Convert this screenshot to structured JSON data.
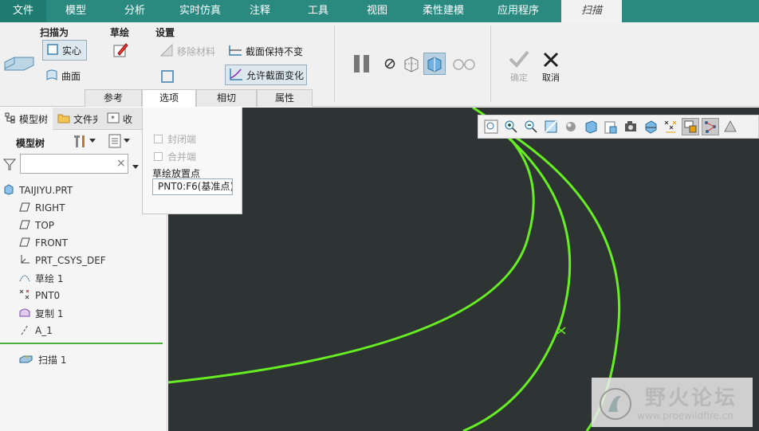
{
  "menubar": {
    "items": [
      {
        "label": "文件"
      },
      {
        "label": "模型"
      },
      {
        "label": "分析"
      },
      {
        "label": "实时仿真"
      },
      {
        "label": "注释"
      },
      {
        "label": "工具"
      },
      {
        "label": "视图"
      },
      {
        "label": "柔性建模"
      },
      {
        "label": "应用程序"
      },
      {
        "label": "扫描"
      }
    ]
  },
  "ribbon": {
    "sweep_as_label": "扫描为",
    "solid_label": "实心",
    "surface_label": "曲面",
    "sketch_label": "草绘",
    "settings_label": "设置",
    "remove_material_label": "移除材料",
    "section_constant_label": "截面保持不变",
    "variable_section_label": "允许截面变化",
    "ok_label": "确定",
    "cancel_label": "取消",
    "subtabs": [
      {
        "label": "参考"
      },
      {
        "label": "选项"
      },
      {
        "label": "相切"
      },
      {
        "label": "属性"
      }
    ]
  },
  "options_popup": {
    "closed_ends_label": "封闭端",
    "merge_ends_label": "合并端",
    "sketch_placement_label": "草绘放置点",
    "placement_value": "PNT0:F6(基准点)"
  },
  "left_panel": {
    "tabs": [
      {
        "label": "模型树"
      },
      {
        "label": "文件夹"
      },
      {
        "label": "收"
      }
    ],
    "tree_label": "模型树",
    "filter_value": "",
    "tree_items": [
      {
        "label": "TAIJIYU.PRT",
        "icon": "part-icon"
      },
      {
        "label": "RIGHT",
        "icon": "datum-plane-icon"
      },
      {
        "label": "TOP",
        "icon": "datum-plane-icon"
      },
      {
        "label": "FRONT",
        "icon": "datum-plane-icon"
      },
      {
        "label": "PRT_CSYS_DEF",
        "icon": "csys-icon"
      },
      {
        "label": "草绘 1",
        "icon": "sketch-icon"
      },
      {
        "label": "PNT0",
        "icon": "datum-point-icon"
      },
      {
        "label": "复制 1",
        "icon": "copy-icon"
      },
      {
        "label": "A_1",
        "icon": "axis-icon"
      },
      {
        "label": "扫描 1",
        "icon": "sweep-icon"
      }
    ]
  },
  "watermark": {
    "title": "野火论坛",
    "url": "www.proewildfire.cn"
  },
  "colors": {
    "menubar": "#2a8a80",
    "canvas": "#2e3333",
    "curve": "#66ee22"
  }
}
